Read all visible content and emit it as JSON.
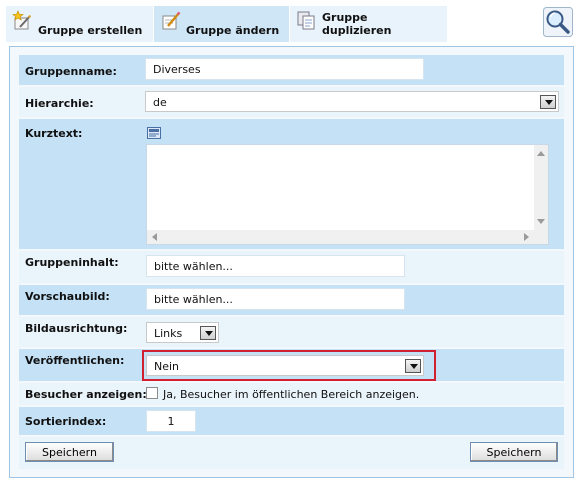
{
  "tabs": [
    {
      "label": "Gruppe erstellen",
      "icon": "star-pencil-icon"
    },
    {
      "label": "Gruppe ändern",
      "icon": "edit-pencil-icon"
    },
    {
      "label": "Gruppe duplizieren",
      "icon": "duplicate-pages-icon"
    }
  ],
  "search_icon": "magnifier-icon",
  "form": {
    "gruppenname": {
      "label": "Gruppenname:",
      "value": "Diverses"
    },
    "hierarchie": {
      "label": "Hierarchie:",
      "value": "de"
    },
    "kurztext": {
      "label": "Kurztext:",
      "value": ""
    },
    "gruppeninhalt": {
      "label": "Gruppeninhalt:",
      "value": "bitte wählen..."
    },
    "vorschaubild": {
      "label": "Vorschaubild:",
      "value": "bitte wählen..."
    },
    "bildausrichtung": {
      "label": "Bildausrichtung:",
      "value": "Links"
    },
    "veroeffentlichen": {
      "label": "Veröffentlichen:",
      "value": "Nein"
    },
    "besucher": {
      "label": "Besucher anzeigen:",
      "checkbox_text": "Ja, Besucher im öffentlichen Bereich anzeigen.",
      "checked": false
    },
    "sortierindex": {
      "label": "Sortierindex:",
      "value": "1"
    }
  },
  "buttons": {
    "save_left": "Speichern",
    "save_right": "Speichern"
  },
  "colors": {
    "row_dark": "#c4e1f6",
    "row_light": "#eaf4fb",
    "highlight": "#d1202f",
    "border": "#9fc4e4"
  }
}
